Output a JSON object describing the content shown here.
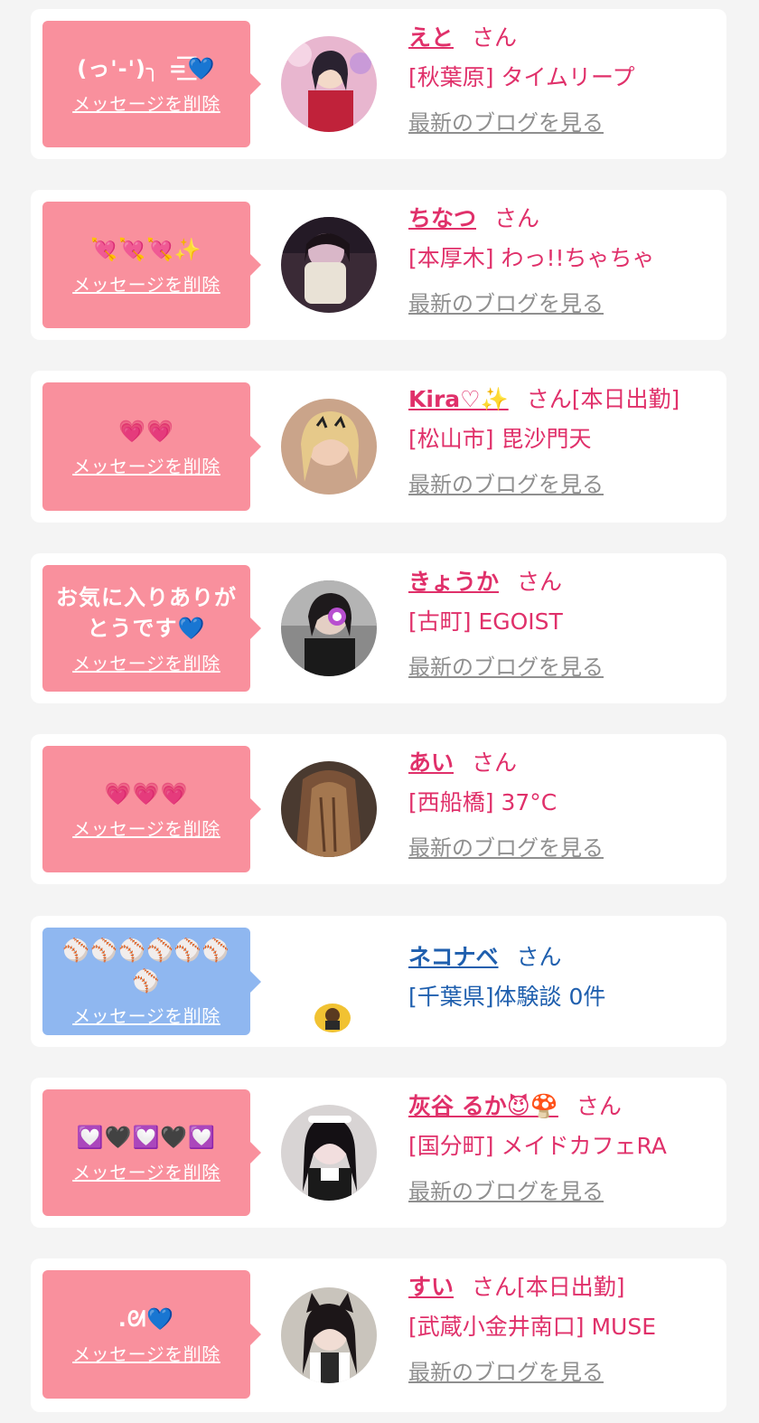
{
  "delete_label": "メッセージを削除",
  "blog_label": "最新のブログを見る",
  "honorific": "さん",
  "colors": {
    "page_background": "#f4f4f4",
    "card_background": "#ffffff",
    "bubble_pink": "#f9909d",
    "bubble_blue": "#8fb7f0",
    "name_pink": "#e0306a",
    "name_blue": "#1f5fae",
    "blog_link_gray": "#8f8f8f"
  },
  "favorites": [
    {
      "message": "(っ'-')╮ =͟͟͞͞💙",
      "name": "えと",
      "status": "",
      "shop": "[秋葉原] タイムリープ",
      "avatar_icon": "girl-photo-pink-kimono"
    },
    {
      "message": "💘💘💘✨",
      "name": "ちなつ",
      "status": "",
      "shop": "[本厚木] わっ!!ちゃちゃ",
      "avatar_icon": "girl-photo-dark-hair"
    },
    {
      "message": "💗💗",
      "name": "Kira♡✨",
      "status": "[本日出勤]",
      "shop": "[松山市] 毘沙門天",
      "avatar_icon": "girl-photo-blonde"
    },
    {
      "message": "お気に入りありがとうです💙",
      "name": "きょうか",
      "status": "",
      "shop": "[古町] EGOIST",
      "avatar_icon": "girl-photo-black-outfit"
    },
    {
      "message": "💗💗💗",
      "name": "あい",
      "status": "",
      "shop": "[西船橋] 37°C",
      "avatar_icon": "girl-photo-long-hair-back"
    },
    {
      "message": "⚾⚾⚾⚾⚾⚾⚾",
      "name": "ネコナベ",
      "status": "",
      "shop": "[千葉県]体験談 0件",
      "avatar_icon": "user-mini-avatar"
    },
    {
      "message": "💟🖤💟🖤💟",
      "name": "灰谷 るか😈🍄",
      "status": "",
      "shop": "[国分町] メイドカフェRA",
      "avatar_icon": "girl-photo-gothic"
    },
    {
      "message": ".ᘛ💙",
      "name": "すい",
      "status": "[本日出勤]",
      "shop": "[武蔵小金井南口] MUSE",
      "avatar_icon": "girl-photo-cat-ears"
    }
  ]
}
